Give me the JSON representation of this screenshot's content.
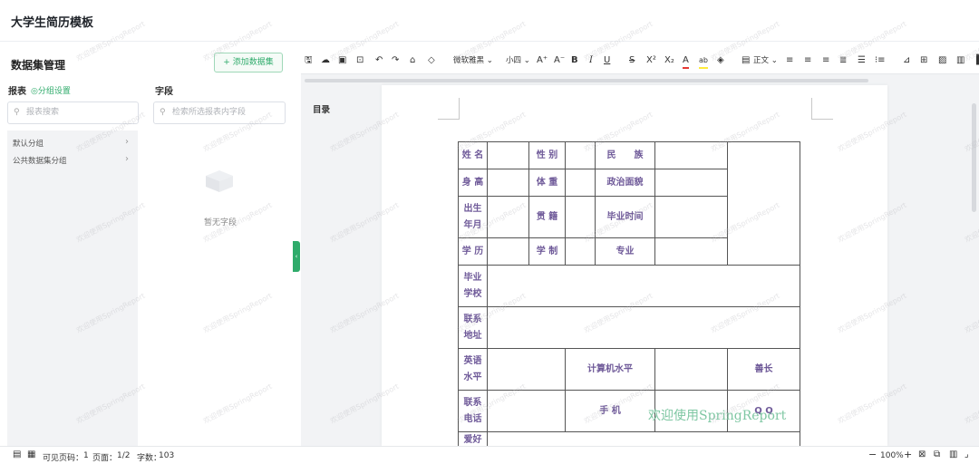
{
  "app": {
    "title": "大学生简历模板"
  },
  "left_panel": {
    "title": "数据集管理",
    "add_button": "+ 添加数据集",
    "report_label": "报表",
    "group_settings": "◎分组设置",
    "report_search_placeholder": "报表搜索",
    "groups": [
      "默认分组",
      "公共数据集分组"
    ],
    "fields_label": "字段",
    "fields_search_placeholder": "检索所选报表内字段",
    "empty_text": "暂无字段"
  },
  "toolbar": {
    "font_name": "微软雅黑",
    "font_size": "小四",
    "para_style": "正文"
  },
  "catalog": {
    "title": "目录"
  },
  "resume": {
    "name": "姓 名",
    "gender": "性 别",
    "ethnicity": "民　　族",
    "height": "身 高",
    "weight": "体 重",
    "politics": "政治面貌",
    "birth": "出生年月",
    "native": "贯 籍",
    "grad_time": "毕业时间",
    "education": "学 历",
    "system": "学 制",
    "major": "专业",
    "school": "毕业学校",
    "address": "联系地址",
    "english": "英语水平",
    "computer": "计算机水平",
    "strength": "善长",
    "phone": "联系电话",
    "mobile": "手 机",
    "qq": "Q Q",
    "hobby": "爱好"
  },
  "page_watermark": "欢迎使用SpringReport",
  "status": {
    "visible_pages_label": "可见页码：",
    "visible_pages": "1",
    "page_label": "页面：",
    "page": "1/2",
    "word_label": "字数：",
    "word_count": "103",
    "zoom": "100%"
  },
  "colors": {
    "accent": "#2fab6b",
    "cell_text": "#6f5a99"
  }
}
